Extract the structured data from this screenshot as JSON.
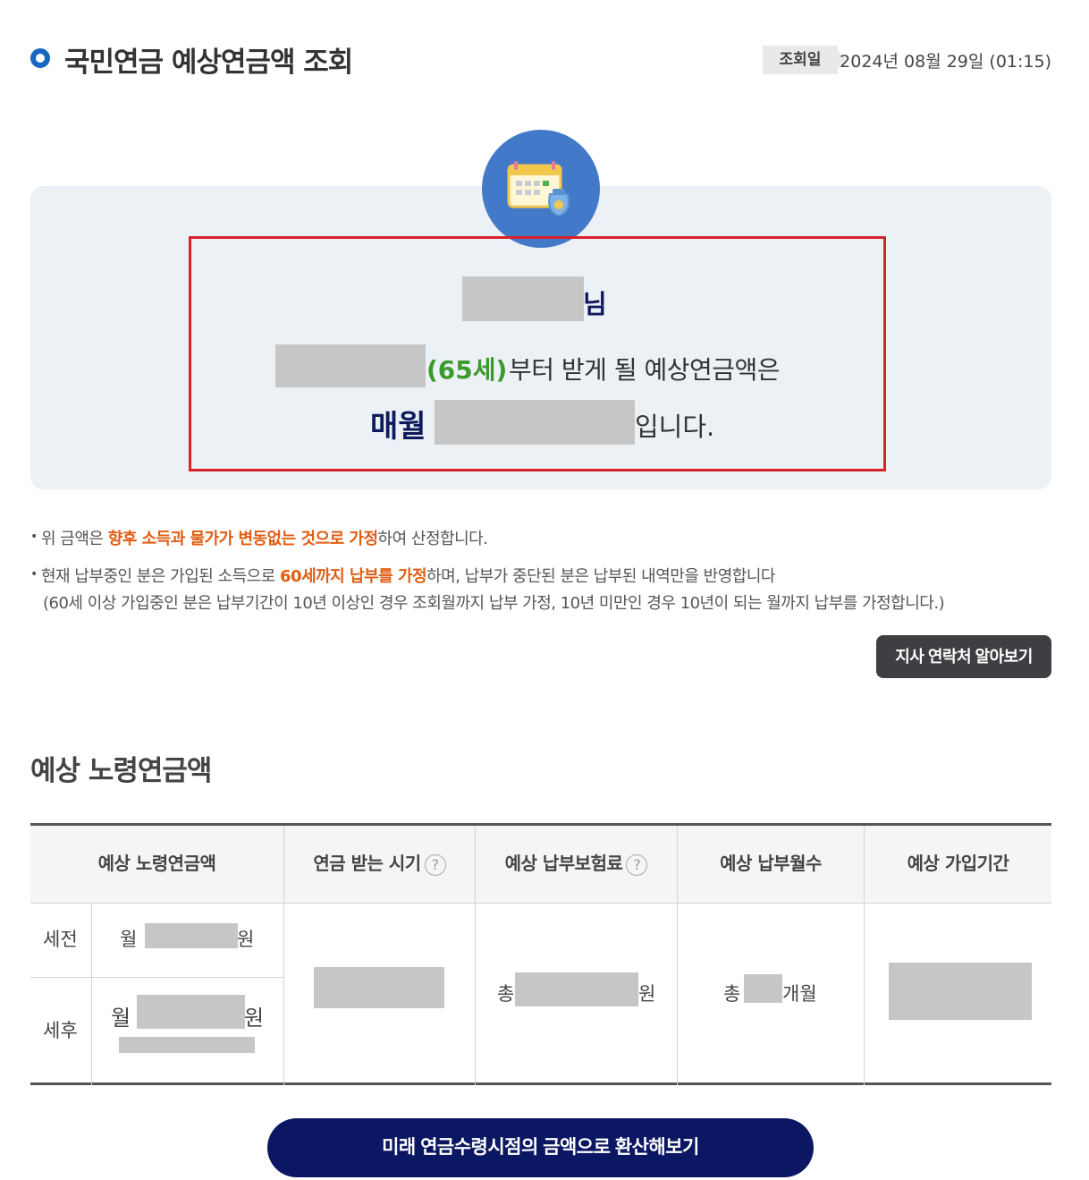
{
  "header": {
    "title": "국민연금 예상연금액 조회",
    "date_label": "조회일",
    "date_value": "2024년 08월 29일 (01:15)"
  },
  "result": {
    "name_suffix": "님",
    "age_text": "(65세)",
    "line2_text": "부터 받게 될 예상연금액은",
    "monthly_label": "매월",
    "ending": "입니다."
  },
  "notes": {
    "note1_pre": "위 금액은 ",
    "note1_em": "향후 소득과 물가가 변동없는 것으로 가정",
    "note1_post": "하여 산정합니다.",
    "note2_pre": "현재 납부중인 분은 가입된 소득으로 ",
    "note2_em": "60세까지 납부를 가정",
    "note2_post": "하며, 납부가 중단된 분은 납부된 내역만을 반영합니다",
    "note3": "(60세 이상 가입중인 분은 납부기간이 10년 이상인 경우 조회월까지 납부 가정, 10년 미만인 경우 10년이 되는 월까지 납부를 가정합니다.)"
  },
  "branch_button": "지사 연락처 알아보기",
  "section_title": "예상 노령연금액",
  "table": {
    "headers": [
      "예상 노령연금액",
      "연금 받는 시기",
      "예상 납부보험료",
      "예상 납부월수",
      "예상 가입기간"
    ],
    "help_glyph": "?",
    "row_pretax": "세전",
    "row_aftertax": "세후",
    "month_prefix": "월",
    "won_suffix": "원",
    "total_prefix": "총",
    "months_suffix": "개월"
  },
  "convert_button": "미래 연금수령시점의 금액으로 환산해보기",
  "colors": {
    "accent_navy": "#0b1762",
    "accent_blue": "#1766c2",
    "highlight_red": "#d9212b",
    "age_green": "#3a9a2c",
    "emphasis_orange": "#e05d12"
  }
}
